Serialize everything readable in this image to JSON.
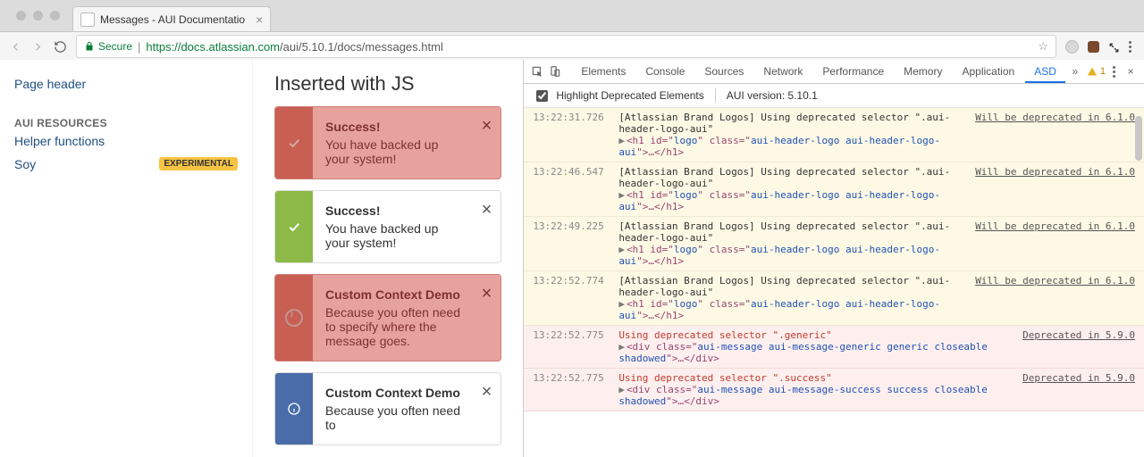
{
  "browser": {
    "tab_title": "Messages - AUI Documentatio",
    "secure_label": "Secure",
    "url_scheme": "https://",
    "url_host": "docs.atlassian.com",
    "url_path": "/aui/5.10.1/docs/messages.html"
  },
  "sidebar": {
    "link_page_header": "Page header",
    "heading_resources": "AUI RESOURCES",
    "link_helper_fns": "Helper functions",
    "link_soy": "Soy",
    "badge_experimental": "EXPERIMENTAL"
  },
  "content": {
    "heading": "Inserted with JS",
    "messages": [
      {
        "title": "Success!",
        "desc": "You have backed up your system!"
      },
      {
        "title": "Success!",
        "desc": "You have backed up your system!"
      },
      {
        "title": "Custom Context Demo",
        "desc": "Because you often need to specify where the message goes."
      },
      {
        "title": "Custom Context Demo",
        "desc": "Because you often need to"
      }
    ]
  },
  "devtools": {
    "tabs": [
      "Elements",
      "Console",
      "Sources",
      "Network",
      "Performance",
      "Memory",
      "Application",
      "ASD"
    ],
    "active_tab": "ASD",
    "warn_count": "1",
    "highlight_label": "Highlight Deprecated Elements",
    "version_label": "AUI version: 5.10.1",
    "warn_link": "Will be deprecated in 6.1.0",
    "err_link": "Deprecated in 5.9.0",
    "brand_msg": "[Atlassian Brand Logos] Using deprecated selector \".aui-header-logo-aui\"",
    "h1_tag_open": "<h1 id=\"",
    "h1_id": "logo",
    "h1_mid": "\" class=\"",
    "h1_class": "aui-header-logo aui-header-logo-aui",
    "h1_close": "\">…</h1>",
    "err_generic": "Using deprecated selector \".generic\"",
    "err_success": "Using deprecated selector \".success\"",
    "div_open": "<div class=\"",
    "div_class_generic": "aui-message aui-message-generic generic closeable shadowed",
    "div_class_success": "aui-message aui-message-success success closeable shadowed",
    "div_close": "\">…</div>",
    "timestamps": [
      "13:22:31.726",
      "13:22:46.547",
      "13:22:49.225",
      "13:22:52.774",
      "13:22:52.775",
      "13:22:52.775"
    ]
  }
}
